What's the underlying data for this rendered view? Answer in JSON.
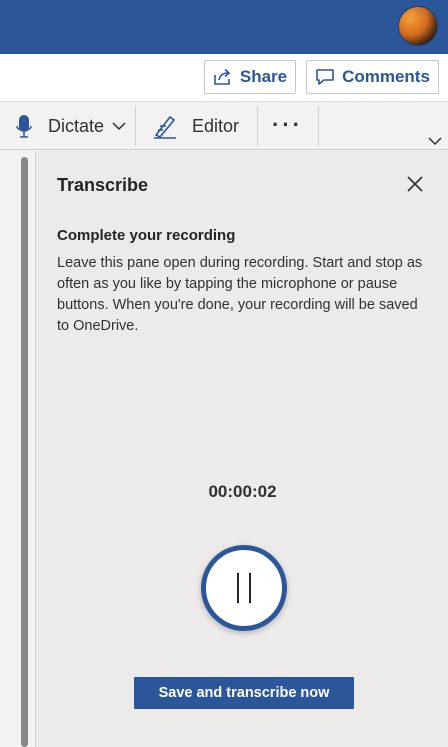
{
  "header": {
    "avatar_icon": "user-avatar",
    "brand_color": "#2b579a"
  },
  "actions": {
    "share_label": "Share",
    "comments_label": "Comments",
    "share_icon": "share-icon",
    "comments_icon": "comment-icon"
  },
  "ribbon": {
    "dictate_label": "Dictate",
    "editor_label": "Editor",
    "more_label": "···"
  },
  "pane": {
    "title": "Transcribe",
    "subtitle": "Complete your recording",
    "description": "Leave this pane open during recording. Start and stop as often as you like by tapping the microphone or pause buttons. When you're done, your recording will be saved to OneDrive.",
    "timer": "00:00:02",
    "save_button": "Save and transcribe now"
  }
}
